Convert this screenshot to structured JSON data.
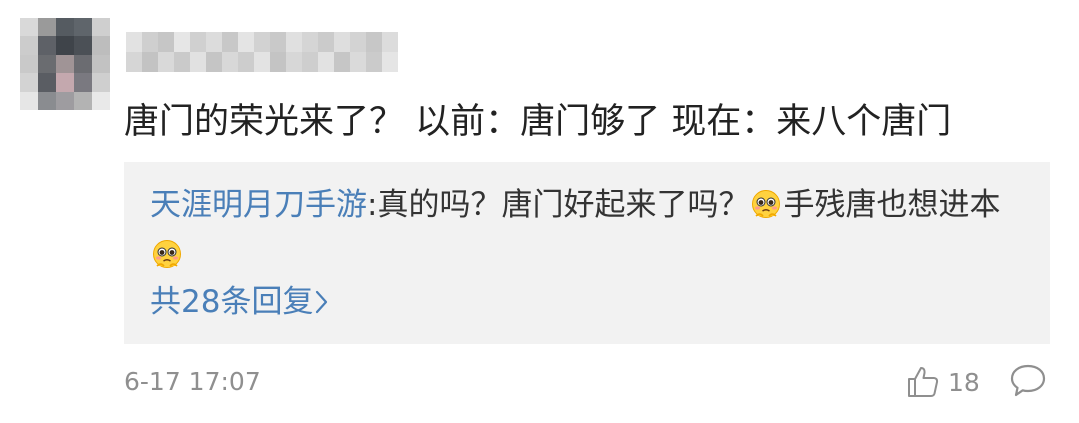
{
  "comment": {
    "text": "唐门的荣光来了？ 以前：唐门够了 现在：来八个唐门",
    "timestamp": "6-17 17:07",
    "like_count": "18"
  },
  "reply": {
    "author": "天涯明月刀手游",
    "text_part1": ":真的吗？唐门好起来了吗？",
    "text_part2": "手残唐也想进本",
    "more_label": "共28条回复"
  },
  "icons": {
    "avatar": "blurred-avatar",
    "username": "blurred-username",
    "emoji": "pleading-face-emoji",
    "more": "chevron-right-icon",
    "like": "thumbs-up-icon",
    "comment": "comment-bubble-icon"
  },
  "colors": {
    "link_blue": "#4a7fb8",
    "reply_bg": "#f2f2f2",
    "meta_gray": "#8f8f8f",
    "text_dark": "#222222"
  }
}
